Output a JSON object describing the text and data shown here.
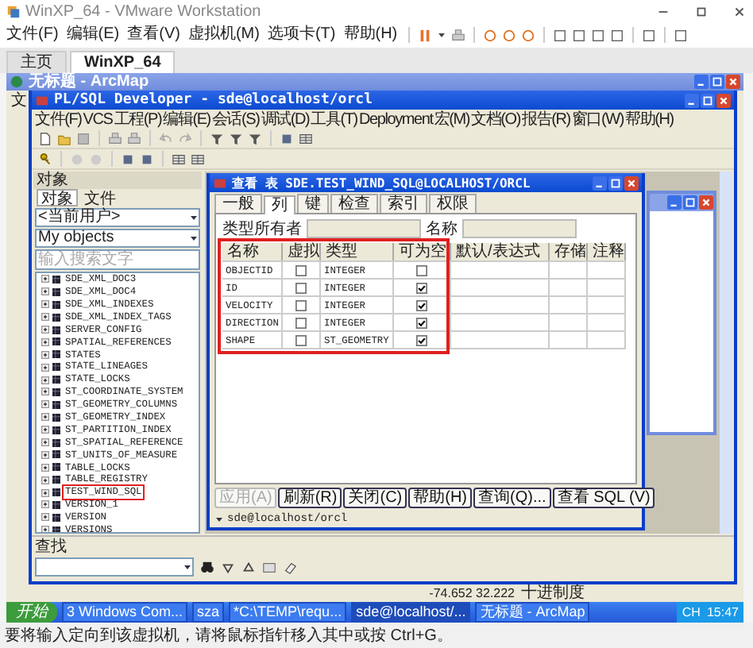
{
  "vmware": {
    "title": "WinXP_64 - VMware Workstation",
    "menu": [
      "文件(F)",
      "编辑(E)",
      "查看(V)",
      "虚拟机(M)",
      "选项卡(T)",
      "帮助(H)"
    ],
    "tabs": [
      {
        "label": "主页",
        "selected": false
      },
      {
        "label": "WinXP_64",
        "selected": true
      }
    ],
    "status": "要将输入定向到该虚拟机，请将鼠标指针移入其中或按 Ctrl+G。"
  },
  "arcmap": {
    "title": "无标题 - ArcMap",
    "menu_partial": "文",
    "coords": "-74.652  32.222",
    "units": "十进制度"
  },
  "plsql": {
    "title": "PL/SQL Developer - sde@localhost/orcl",
    "menu": [
      "文件(F)",
      "VCS",
      "工程(P)",
      "编辑(E)",
      "会话(S)",
      "调试(D)",
      "工具(T)",
      "Deployment",
      "宏(M)",
      "文档(O)",
      "报告(R)",
      "窗口(W)",
      "帮助(H)"
    ],
    "object_browser": {
      "title": "对象",
      "tabs": [
        {
          "label": "对象",
          "selected": true
        },
        {
          "label": "文件",
          "selected": false
        }
      ],
      "user_combo": "<当前用户>",
      "filter_combo": "My objects",
      "search": {
        "placeholder": "输入搜索文字"
      },
      "items": [
        {
          "label": "SDE_XML_DOC3",
          "highlighted": false
        },
        {
          "label": "SDE_XML_DOC4",
          "highlighted": false
        },
        {
          "label": "SDE_XML_INDEXES",
          "highlighted": false
        },
        {
          "label": "SDE_XML_INDEX_TAGS",
          "highlighted": false
        },
        {
          "label": "SERVER_CONFIG",
          "highlighted": false
        },
        {
          "label": "SPATIAL_REFERENCES",
          "highlighted": false
        },
        {
          "label": "STATES",
          "highlighted": false
        },
        {
          "label": "STATE_LINEAGES",
          "highlighted": false
        },
        {
          "label": "STATE_LOCKS",
          "highlighted": false
        },
        {
          "label": "ST_COORDINATE_SYSTEM",
          "highlighted": false
        },
        {
          "label": "ST_GEOMETRY_COLUMNS",
          "highlighted": false
        },
        {
          "label": "ST_GEOMETRY_INDEX",
          "highlighted": false
        },
        {
          "label": "ST_PARTITION_INDEX",
          "highlighted": false
        },
        {
          "label": "ST_SPATIAL_REFERENCE",
          "highlighted": false
        },
        {
          "label": "ST_UNITS_OF_MEASURE",
          "highlighted": false
        },
        {
          "label": "TABLE_LOCKS",
          "highlighted": false
        },
        {
          "label": "TABLE_REGISTRY",
          "highlighted": false
        },
        {
          "label": "TEST_WIND_SQL",
          "highlighted": true
        },
        {
          "label": "VERSION_1",
          "highlighted": false
        },
        {
          "label": "VERSION",
          "highlighted": false
        },
        {
          "label": "VERSIONS",
          "highlighted": false
        }
      ]
    },
    "dialog": {
      "title": "查看 表 SDE.TEST_WIND_SQL@LOCALHOST/ORCL",
      "tabs": [
        {
          "label": "一般",
          "selected": false
        },
        {
          "label": "列",
          "selected": true
        },
        {
          "label": "键",
          "selected": false
        },
        {
          "label": "检查",
          "selected": false
        },
        {
          "label": "索引",
          "selected": false
        },
        {
          "label": "权限",
          "selected": false
        }
      ],
      "owner_label": "类型所有者",
      "name_label": "名称",
      "columns": [
        "名称",
        "虚拟",
        "类型",
        "可为空",
        "默认/表达式",
        "存储",
        "注释"
      ],
      "highlighted": true,
      "rows": [
        {
          "name": "OBJECTID",
          "virtual": false,
          "type": "INTEGER",
          "nullable": false
        },
        {
          "name": "ID",
          "virtual": false,
          "type": "INTEGER",
          "nullable": true
        },
        {
          "name": "VELOCITY",
          "virtual": false,
          "type": "INTEGER",
          "nullable": true
        },
        {
          "name": "DIRECTION",
          "virtual": false,
          "type": "INTEGER",
          "nullable": true
        },
        {
          "name": "SHAPE",
          "virtual": false,
          "type": "ST_GEOMETRY",
          "nullable": true
        }
      ],
      "buttons": [
        {
          "label": "应用(A)",
          "disabled": true
        },
        {
          "label": "刷新(R)",
          "disabled": false
        },
        {
          "label": "关闭(C)",
          "disabled": false
        },
        {
          "label": "帮助(H)",
          "disabled": false
        },
        {
          "label": "查询(Q)...",
          "disabled": false
        },
        {
          "label": "查看 SQL (V)",
          "disabled": false
        }
      ],
      "connection": "sde@localhost/orcl"
    },
    "find": {
      "title": "查找"
    }
  },
  "taskbar": {
    "start": "开始",
    "items": [
      {
        "label": "3 Windows Com...",
        "selected": false
      },
      {
        "label": "sza",
        "selected": false
      },
      {
        "label": "*C:\\TEMP\\requ...",
        "selected": false
      },
      {
        "label": "sde@localhost/...",
        "selected": true
      },
      {
        "label": "无标题 - ArcMap",
        "selected": false
      }
    ],
    "language": "CH",
    "clock": "15:47"
  }
}
